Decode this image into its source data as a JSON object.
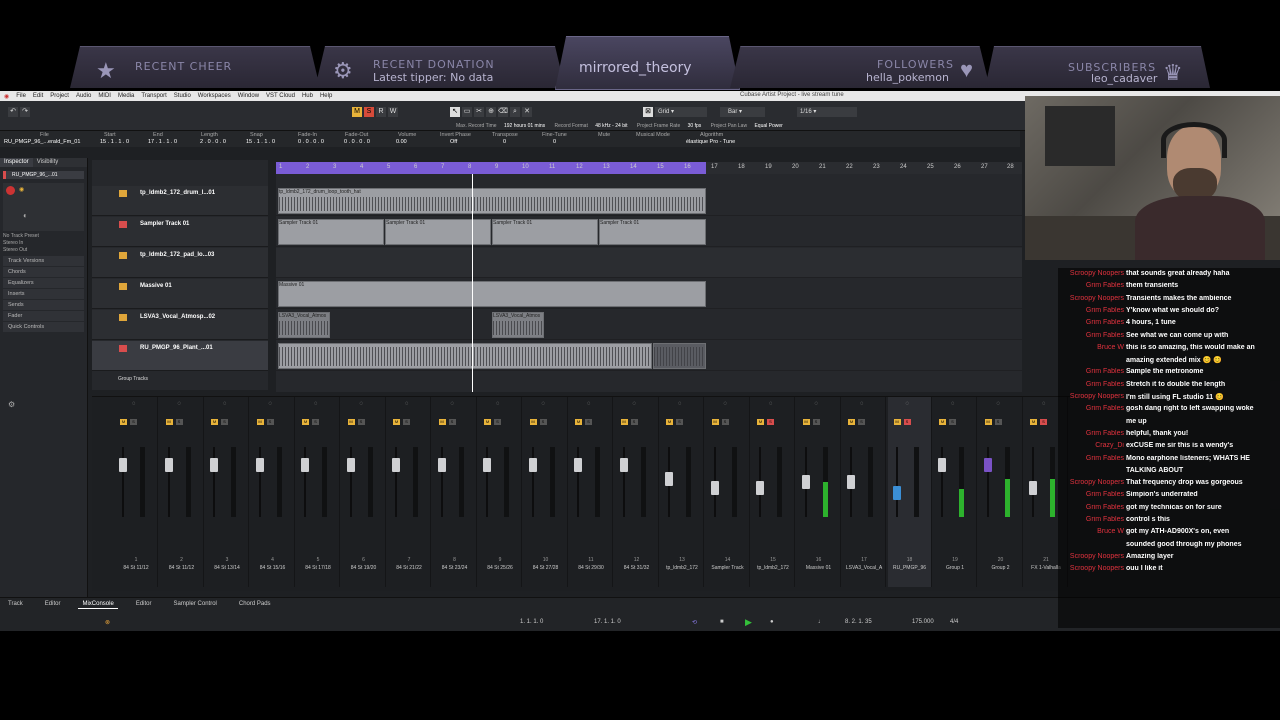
{
  "overlay": {
    "recent_cheer_label": "RECENT CHEER",
    "recent_donation_label": "RECENT DONATION",
    "recent_donation_value": "Latest tipper: No data",
    "channel_name": "mirrored_theory",
    "followers_label": "FOLLOWERS",
    "followers_value": "hella_pokemon",
    "subscribers_label": "SUBSCRIBERS",
    "subscribers_value": "leo_cadaver",
    "icons": [
      "star-icon",
      "money-icon",
      "heart-icon",
      "trophy-icon"
    ]
  },
  "daw": {
    "window_title": "Cubase Artist Project - live stream tune",
    "menu": [
      "File",
      "Edit",
      "Project",
      "Audio",
      "MIDI",
      "Media",
      "Transport",
      "Studio",
      "Workspaces",
      "Window",
      "VST Cloud",
      "Hub",
      "Help"
    ],
    "toolbar": {
      "grid_label": "Grid",
      "grid_type": "Bar",
      "quantize": "1/16",
      "max_record_time": "Max. Record Time",
      "max_record_value": "192 hours 01 mins",
      "record_format_label": "Record Format",
      "record_format_value": "48 kHz - 24 bit",
      "frame_rate_label": "Project Frame Rate",
      "frame_rate_value": "30 fps",
      "pan_law_label": "Project Pan Law",
      "pan_law_value": "Equal Power"
    },
    "infoline": {
      "track_name": "RU_PMGP_96_...erald_Fm_01",
      "start": "15 . 1 . 1 . 0",
      "end": "17 . 1 . 1 . 0",
      "length": "2 . 0 . 0 . 0",
      "snap": "15 . 1 . 1 . 0",
      "fade_in": "0 . 0 . 0 . 0",
      "fade_out": "0 . 0 . 0 . 0",
      "volume": "0.00",
      "invert_phase": "Off",
      "transpose": "0",
      "fine_tune": "0",
      "mute": "",
      "musical_mode": "",
      "algorithm": "élastique Pro - Tune",
      "labels": [
        "File",
        "Start",
        "End",
        "Length",
        "Snap",
        "Fade-In",
        "Fade-Out",
        "Volume",
        "Invert Phase",
        "Transpose",
        "Fine-Tune",
        "Mute",
        "Musical Mode",
        "Algorithm"
      ]
    },
    "inspector": {
      "tabs": [
        "Inspector",
        "Visibility"
      ],
      "track_label": "RU_PMGP_96_...01",
      "routing": [
        "No Track Preset",
        "Stereo In",
        "Stereo Out"
      ],
      "sections": [
        "Track Versions",
        "Chords",
        "Equalizers",
        "Inserts",
        "Sends",
        "Fader",
        "Quick Controls"
      ]
    },
    "tracks": [
      {
        "name": "tp_ldmb2_172_drum_l...01",
        "color": "#e0a63a"
      },
      {
        "name": "Sampler Track 01",
        "color": "#d84d4d"
      },
      {
        "name": "tp_ldmb2_172_pad_lo...03",
        "color": "#e0a63a"
      },
      {
        "name": "Massive 01",
        "color": "#e0a63a"
      },
      {
        "name": "LSVA3_Vocal_Atmosp...02",
        "color": "#e0a63a"
      },
      {
        "name": "RU_PMGP_96_Plant_...01",
        "color": "#d84d4d"
      }
    ],
    "group_tracks_label": "Group Tracks",
    "ruler": [
      "1",
      "2",
      "3",
      "4",
      "5",
      "6",
      "7",
      "8",
      "9",
      "10",
      "11",
      "12",
      "13",
      "14",
      "15",
      "16",
      "17",
      "18",
      "19",
      "20",
      "21",
      "22",
      "23",
      "24",
      "25",
      "26",
      "27",
      "28"
    ],
    "events": {
      "drum": "tp_ldmb2_172_drum_loop_tooth_hat",
      "sampler": "Sampler Track 01",
      "massive": "Massive 01",
      "vocal": "LSVA3_Vocal_Atmos"
    },
    "mixer": {
      "channels": [
        {
          "num": "1",
          "name": "84 St 11/12"
        },
        {
          "num": "2",
          "name": "84 St 11/12"
        },
        {
          "num": "3",
          "name": "84 St 13/14"
        },
        {
          "num": "4",
          "name": "84 St 15/16"
        },
        {
          "num": "5",
          "name": "84 St 17/18"
        },
        {
          "num": "6",
          "name": "84 St 19/20"
        },
        {
          "num": "7",
          "name": "84 St 21/22"
        },
        {
          "num": "8",
          "name": "84 St 23/24"
        },
        {
          "num": "9",
          "name": "84 St 25/26"
        },
        {
          "num": "10",
          "name": "84 St 27/28"
        },
        {
          "num": "11",
          "name": "84 St 29/30"
        },
        {
          "num": "12",
          "name": "84 St 31/32"
        },
        {
          "num": "13",
          "name": "tp_ldmb2_172"
        },
        {
          "num": "14",
          "name": "Sampler Track"
        },
        {
          "num": "15",
          "name": "tp_ldmb2_172"
        },
        {
          "num": "16",
          "name": "Massive 01"
        },
        {
          "num": "17",
          "name": "LSVA3_Vocal_A"
        },
        {
          "num": "18",
          "name": "RU_PMGP_96"
        },
        {
          "num": "19",
          "name": "Group 1"
        },
        {
          "num": "20",
          "name": "Group 2"
        },
        {
          "num": "21",
          "name": "FX 1-Valhalla"
        }
      ]
    },
    "bottom_tabs": [
      "Track",
      "Editor",
      "MixConsole",
      "Editor",
      "Sampler Control",
      "Chord Pads"
    ],
    "transport": {
      "left_locator": "1. 1. 1. 0",
      "right_locator": "17. 1. 1. 0",
      "position": "8. 2. 1. 35",
      "tempo": "175.000",
      "signature": "4/4"
    }
  },
  "chat": [
    {
      "user": "Scroopy Noopers",
      "msg": "that sounds great already haha"
    },
    {
      "user": "Grim Fables",
      "msg": "them transients"
    },
    {
      "user": "Scroopy Noopers",
      "msg": "Transients makes the ambience"
    },
    {
      "user": "Grim Fables",
      "msg": "Y'know what we should do?"
    },
    {
      "user": "Grim Fables",
      "msg": "4 hours, 1 tune"
    },
    {
      "user": "Grim Fables",
      "msg": "See what we can come up with"
    },
    {
      "user": "Bruce W",
      "msg": "this is so amazing, this would make an"
    },
    {
      "user": "",
      "msg": "amazing extended mix 😊 😊"
    },
    {
      "user": "Grim Fables",
      "msg": "Sample the metronome"
    },
    {
      "user": "Grim Fables",
      "msg": "Stretch it to double the length"
    },
    {
      "user": "Scroopy Noopers",
      "msg": "I'm still using FL studio 11 😊"
    },
    {
      "user": "Grim Fables",
      "msg": "gosh dang right to left swapping woke"
    },
    {
      "user": "",
      "msg": "me up"
    },
    {
      "user": "Grim Fables",
      "msg": "helpful, thank you!"
    },
    {
      "user": "Crazy_Di",
      "msg": "exCUSE me sir this is a wendy's"
    },
    {
      "user": "Grim Fables",
      "msg": "Mono earphone listeners; WHATS HE"
    },
    {
      "user": "",
      "msg": "TALKING ABOUT"
    },
    {
      "user": "Scroopy Noopers",
      "msg": "That frequency drop was gorgeous"
    },
    {
      "user": "Grim Fables",
      "msg": "Simpion's underrated"
    },
    {
      "user": "Grim Fables",
      "msg": "got my technicas on for sure"
    },
    {
      "user": "Grim Fables",
      "msg": "control s this"
    },
    {
      "user": "Bruce W",
      "msg": "got my ATH-AD900X's on, even"
    },
    {
      "user": "",
      "msg": "sounded good through my phones"
    },
    {
      "user": "Scroopy Noopers",
      "msg": "Amazing layer"
    },
    {
      "user": "Scroopy Noopers",
      "msg": "ouu I like it"
    }
  ]
}
